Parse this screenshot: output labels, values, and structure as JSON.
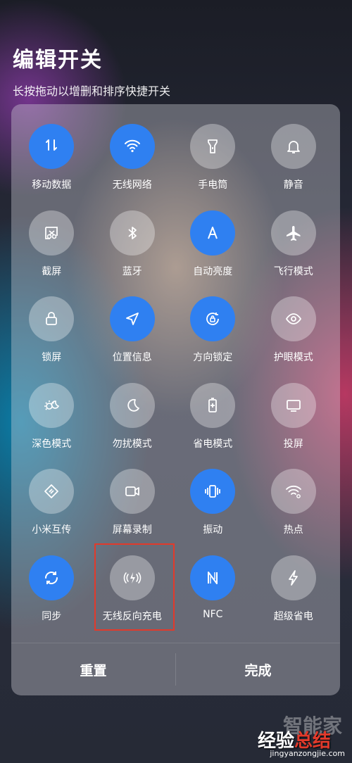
{
  "header": {
    "title": "编辑开关",
    "subtitle": "长按拖动以增删和排序快捷开关"
  },
  "colors": {
    "accent": "#2f80f1",
    "highlight": "#e23a2b"
  },
  "tiles": [
    {
      "label": "移动数据",
      "icon": "mobile-data-icon",
      "active": true
    },
    {
      "label": "无线网络",
      "icon": "wifi-icon",
      "active": true
    },
    {
      "label": "手电筒",
      "icon": "flashlight-icon",
      "active": false
    },
    {
      "label": "静音",
      "icon": "bell-icon",
      "active": false
    },
    {
      "label": "截屏",
      "icon": "screenshot-icon",
      "active": false
    },
    {
      "label": "蓝牙",
      "icon": "bluetooth-icon",
      "active": false
    },
    {
      "label": "自动亮度",
      "icon": "auto-brightness-icon",
      "active": true
    },
    {
      "label": "飞行模式",
      "icon": "airplane-icon",
      "active": false
    },
    {
      "label": "锁屏",
      "icon": "lock-icon",
      "active": false
    },
    {
      "label": "位置信息",
      "icon": "location-icon",
      "active": true
    },
    {
      "label": "方向锁定",
      "icon": "rotation-lock-icon",
      "active": true
    },
    {
      "label": "护眼模式",
      "icon": "eye-icon",
      "active": false
    },
    {
      "label": "深色模式",
      "icon": "dark-mode-icon",
      "active": false
    },
    {
      "label": "勿扰模式",
      "icon": "moon-icon",
      "active": false
    },
    {
      "label": "省电模式",
      "icon": "battery-saver-icon",
      "active": false
    },
    {
      "label": "投屏",
      "icon": "cast-screen-icon",
      "active": false
    },
    {
      "label": "小米互传",
      "icon": "mi-share-icon",
      "active": false
    },
    {
      "label": "屏幕录制",
      "icon": "screen-record-icon",
      "active": false
    },
    {
      "label": "振动",
      "icon": "vibrate-icon",
      "active": true
    },
    {
      "label": "热点",
      "icon": "hotspot-icon",
      "active": false
    },
    {
      "label": "同步",
      "icon": "sync-icon",
      "active": true
    },
    {
      "label": "无线反向充电",
      "icon": "reverse-wireless-charging-icon",
      "active": false
    },
    {
      "label": "NFC",
      "icon": "nfc-icon",
      "active": true
    },
    {
      "label": "超级省电",
      "icon": "lightning-icon",
      "active": false
    }
  ],
  "footer": {
    "reset_label": "重置",
    "done_label": "完成"
  },
  "watermark": {
    "line1": "智能家",
    "line2_prefix": "经验",
    "line2_red": "总结",
    "line2_suffix": "",
    "url": "jingyanzongjie.com"
  }
}
